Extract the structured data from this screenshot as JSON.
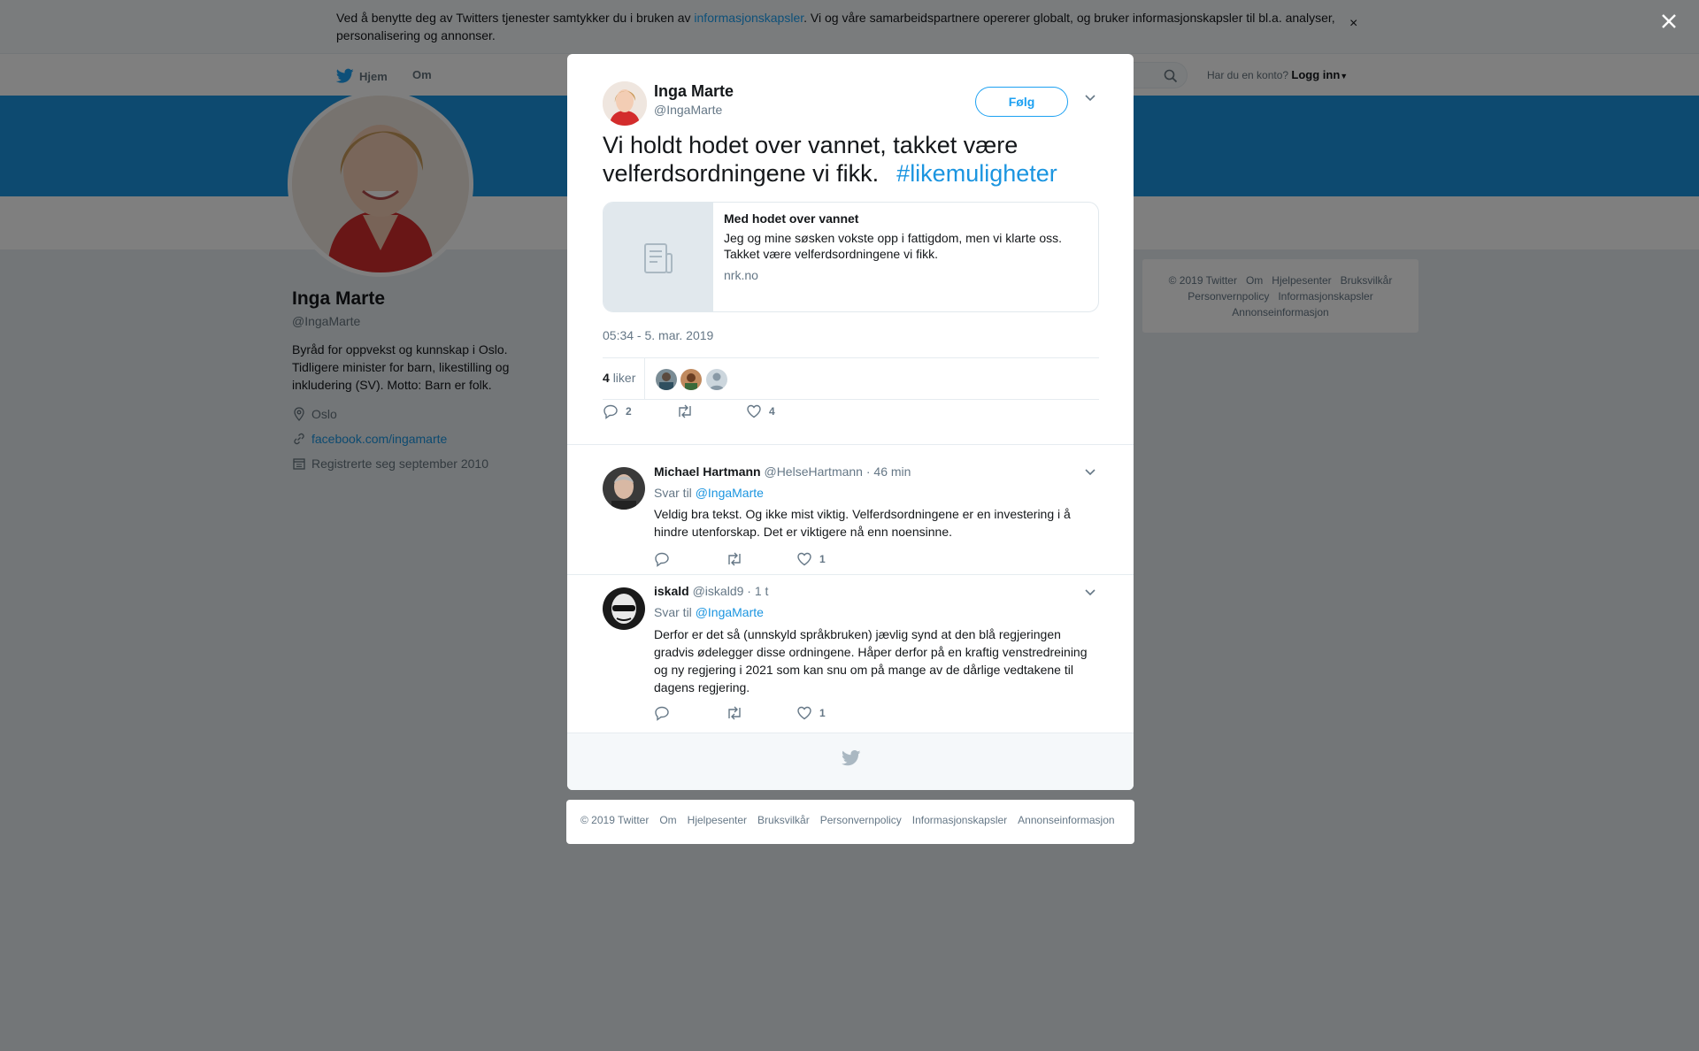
{
  "cookie": {
    "text_before": "Ved å benytte deg av Twitters tjenester samtykker du i bruken av ",
    "link": "informasjonskapsler",
    "text_after": ". Vi og våre samarbeidspartnere opererer globalt, og bruker informasjonskapsler til bl.a. analyser, personalisering og annonser.",
    "close": "×"
  },
  "nav": {
    "home": "Hjem",
    "about": "Om",
    "login_prompt": "Har du en konto?",
    "login": "Logg inn"
  },
  "profile": {
    "name": "Inga Marte",
    "handle": "@IngaMarte",
    "bio": "Byråd for oppvekst og kunnskap i Oslo. Tidligere minister for barn, likestilling og inkludering (SV). Motto: Barn er folk.",
    "location": "Oslo",
    "url": "facebook.com/ingamarte",
    "joined": "Registrerte seg september 2010"
  },
  "side_footer": [
    "© 2019 Twitter",
    "Om",
    "Hjelpesenter",
    "Bruksvilkår",
    "Personvernpolicy",
    "Informasjonskapsler",
    "Annonseinformasjon"
  ],
  "tweet": {
    "name": "Inga Marte",
    "handle": "@IngaMarte",
    "follow": "Følg",
    "text": "Vi holdt hodet over vannet, takket være velferdsordningene vi fikk.",
    "hashtag": "#likemuligheter",
    "card": {
      "title": "Med hodet over vannet",
      "description": "Jeg og mine søsken vokste opp i fattigdom, men vi klarte oss. Takket være velferdsordningene vi fikk.",
      "domain": "nrk.no"
    },
    "timestamp": "05:34 - 5. mar. 2019",
    "likes_count": "4",
    "likes_label": "liker",
    "reply_count": "2",
    "retweet_count": "",
    "like_count": "4"
  },
  "replies": [
    {
      "name": "Michael Hartmann",
      "handle": "@HelseHartmann",
      "time": "· 46 min",
      "reply_to_label": "Svar til",
      "reply_to": "@IngaMarte",
      "text": "Veldig bra tekst. Og ikke mist viktig. Velferdsordningene er en investering i å hindre utenforskap. Det er viktigere nå enn noensinne.",
      "reply_count": "",
      "retweet_count": "",
      "like_count": "1"
    },
    {
      "name": "iskald",
      "handle": "@iskald9",
      "time": "· 1 t",
      "reply_to_label": "Svar til",
      "reply_to": "@IngaMarte",
      "text": "Derfor er det så (unnskyld språkbruken) jævlig synd at den blå regjeringen gradvis ødelegger disse ordningene. Håper derfor på en kraftig venstredreining og ny regjering i 2021 som kan snu om på mange av de dårlige vedtakene til dagens regjering.",
      "reply_count": "",
      "retweet_count": "",
      "like_count": "1"
    }
  ],
  "bottom_footer": [
    "© 2019 Twitter",
    "Om",
    "Hjelpesenter",
    "Bruksvilkår",
    "Personvernpolicy",
    "Informasjonskapsler",
    "Annonseinformasjon"
  ],
  "colors": {
    "accent": "#1da1f2",
    "link": "#1b95e0",
    "banner": "#1b95e0"
  },
  "icons": [
    "twitter-bird-icon",
    "search-icon",
    "close-icon",
    "chevron-down-icon",
    "location-icon",
    "link-icon",
    "calendar-icon",
    "reply-icon",
    "retweet-icon",
    "heart-icon",
    "article-icon"
  ]
}
